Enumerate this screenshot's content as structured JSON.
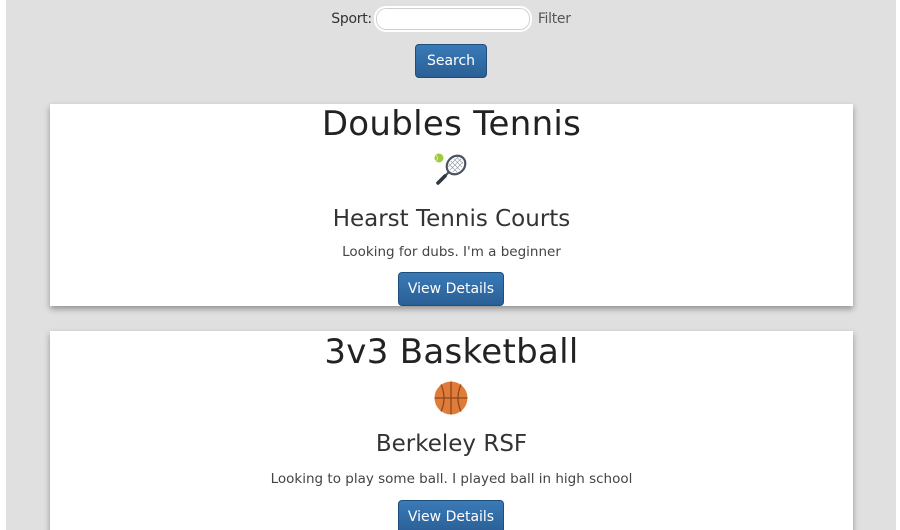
{
  "search": {
    "label": "Sport:",
    "value": "",
    "placeholder": "",
    "filter_label": "Filter",
    "button_label": "Search"
  },
  "cards": [
    {
      "title": "Doubles Tennis",
      "icon": "tennis-racket-icon",
      "location": "Hearst Tennis Courts",
      "description": "Looking for dubs. I'm a beginner",
      "button_label": "View Details"
    },
    {
      "title": "3v3 Basketball",
      "icon": "basketball-icon",
      "location": "Berkeley RSF",
      "description": "Looking to play some ball. I played ball in high school",
      "button_label": "View Details"
    }
  ],
  "colors": {
    "background": "#e0e0e0",
    "card": "#ffffff",
    "button": "#2d6399",
    "button_text": "#ffffff",
    "basketball": "#e07b39",
    "tennis_ball": "#9ccc3d"
  }
}
